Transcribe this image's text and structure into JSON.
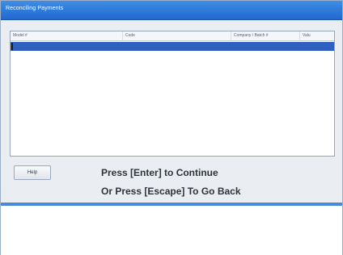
{
  "window": {
    "title": "Reconciling Payments"
  },
  "list": {
    "columns": [
      "Model #",
      "Code",
      "Company / Batch #",
      "Valu"
    ],
    "rows": [
      {
        "selected": true,
        "cells": [
          "",
          "",
          "",
          ""
        ]
      }
    ]
  },
  "controls": {
    "button_label": "Help"
  },
  "instructions": {
    "line1": "Press [Enter] to Continue",
    "line2": "Or Press [Escape] To Go Back"
  }
}
